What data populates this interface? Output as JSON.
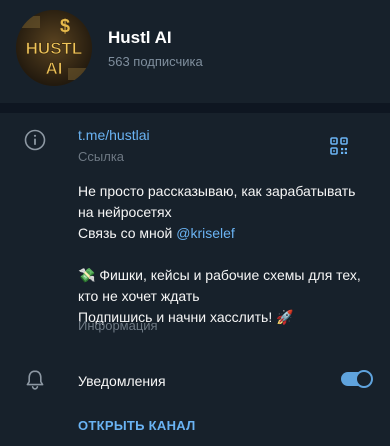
{
  "channel": {
    "name": "Hustl AI",
    "subscribers": "563 подписчика",
    "avatar_text": "HUSTL AI"
  },
  "link": {
    "url": "t.me/hustlai",
    "caption": "Ссылка"
  },
  "description": {
    "line1": "Не просто рассказываю, как зарабатывать на нейросетях",
    "line2_prefix": "Связь со мной ",
    "mention": "@kriselef",
    "line3": "💸 Фишки, кейсы и рабочие схемы для тех, кто не хочет ждать",
    "line4": "Подпишись и начни хасслить! 🚀",
    "caption": "Информация"
  },
  "notifications": {
    "label": "Уведомления",
    "enabled": true
  },
  "actions": {
    "open_channel": "ОТКРЫТЬ КАНАЛ"
  },
  "colors": {
    "background": "#17212b",
    "divider": "#0e1621",
    "accent": "#6ab3f3",
    "muted": "#6d7883"
  }
}
